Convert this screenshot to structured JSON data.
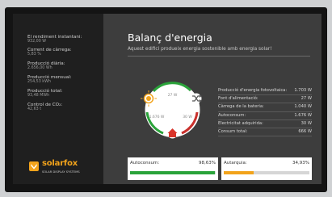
{
  "colors": {
    "green": "#2aa33a",
    "orange": "#f2a31b",
    "red": "#c9302c",
    "house_red": "#d9352b"
  },
  "sidebar": {
    "items": [
      {
        "label": "El rendiment instantani:",
        "value": "932,00 W"
      },
      {
        "label": "Corrent de càrrega:",
        "value": "5,83 %"
      },
      {
        "label": "Producció diària:",
        "value": "2.656,00 Wh"
      },
      {
        "label": "Producció mensual:",
        "value": "254,53 kWh"
      },
      {
        "label": "Producció total:",
        "value": "93,48 MWh"
      },
      {
        "label": "Control de CO₂:",
        "value": "42,63 t"
      }
    ],
    "brand": {
      "name": "solarfox",
      "tagline": "SOLAR DISPLAY SYSTEMS"
    }
  },
  "main": {
    "title": "Balanç d'energia",
    "subtitle": "Aquest edifici produeix energia sostenible amb energia solar!",
    "diagram": {
      "top_label": "27 W",
      "left_label": "1.676 W",
      "right_label": "30 W",
      "icons": [
        "sun-icon",
        "shuffle-icon",
        "home-icon"
      ]
    },
    "table": [
      {
        "label": "Producció d'energia fotovoltaica:",
        "value": "1.703 W"
      },
      {
        "label": "Font d'alimentació:",
        "value": "27 W"
      },
      {
        "label": "Càrrega de la bateria:",
        "value": "1.040 W"
      },
      {
        "label": "Autoconsum:",
        "value": "1.676 W"
      },
      {
        "label": "Electricitat adquirida:",
        "value": "30 W"
      },
      {
        "label": "Consum total:",
        "value": "666 W"
      }
    ],
    "autoconsum": {
      "label": "Autoconsum:",
      "value": "98,63%",
      "fraction": 0.9863
    },
    "autarquia": {
      "label": "Autarquia:",
      "value": "34,93%",
      "fraction": 0.3493
    }
  }
}
